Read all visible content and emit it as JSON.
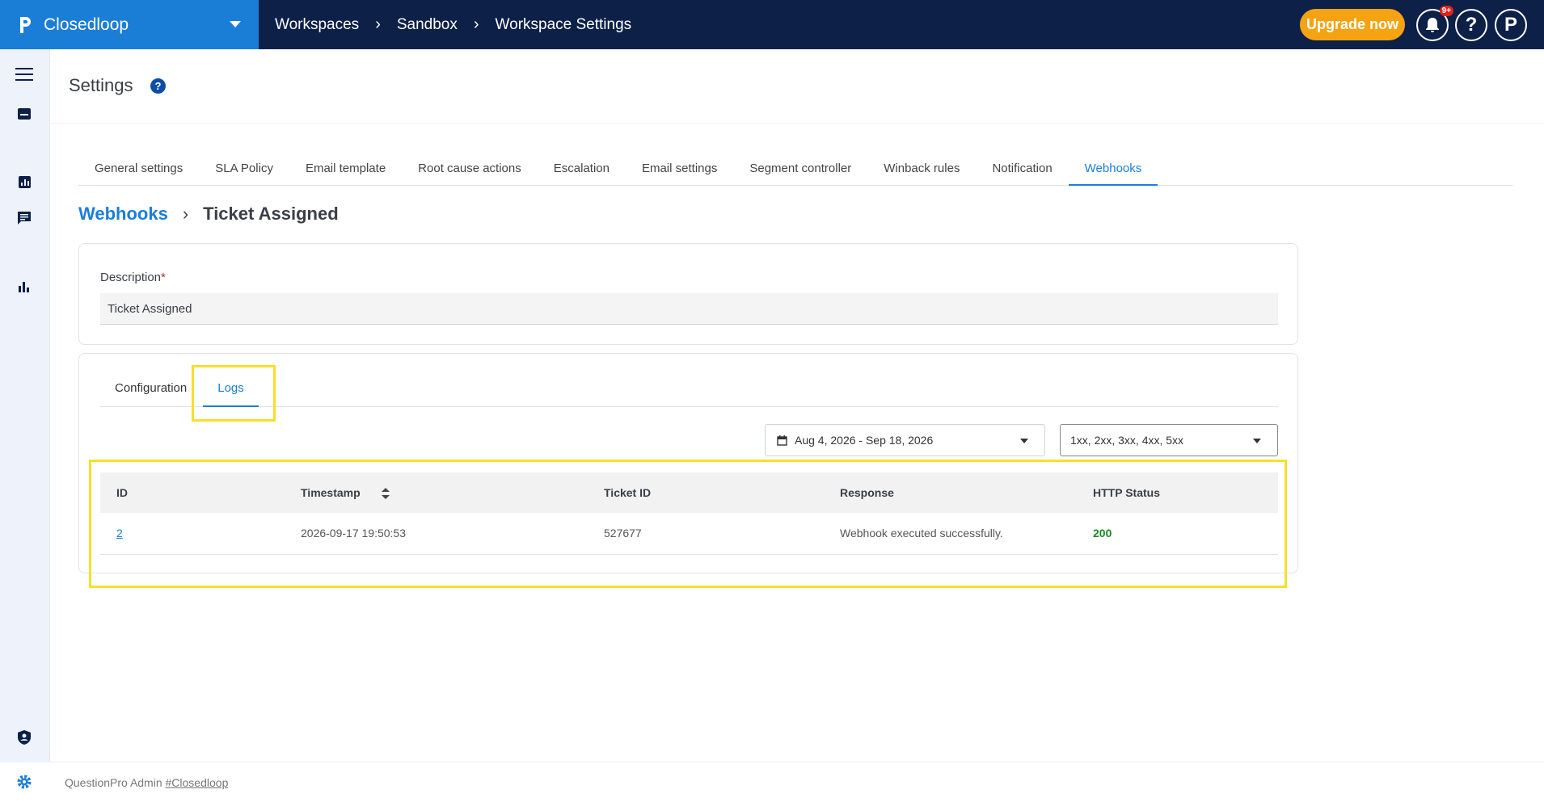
{
  "topbar": {
    "brand_name": "Closedloop",
    "breadcrumbs": [
      "Workspaces",
      "Sandbox",
      "Workspace Settings"
    ],
    "upgrade_label": "Upgrade now",
    "notification_badge": "9+",
    "help_glyph": "?",
    "profile_glyph": "P"
  },
  "sidebar": {
    "icons": [
      "menu-icon",
      "inbox-icon",
      "report-icon",
      "chat-icon",
      "bar-chart-icon",
      "shield-user-icon",
      "gear-icon"
    ]
  },
  "header": {
    "title": "Settings",
    "help_glyph": "?"
  },
  "tabs": [
    {
      "label": "General settings"
    },
    {
      "label": "SLA Policy"
    },
    {
      "label": "Email template"
    },
    {
      "label": "Root cause actions"
    },
    {
      "label": "Escalation"
    },
    {
      "label": "Email settings"
    },
    {
      "label": "Segment controller"
    },
    {
      "label": "Winback rules"
    },
    {
      "label": "Notification"
    },
    {
      "label": "Webhooks"
    }
  ],
  "active_tab": "Webhooks",
  "breadcrumb": {
    "parent": "Webhooks",
    "current": "Ticket Assigned"
  },
  "description": {
    "label": "Description",
    "required_mark": "*",
    "value": "Ticket Assigned"
  },
  "subtabs": [
    {
      "label": "Configuration"
    },
    {
      "label": "Logs"
    }
  ],
  "active_subtab": "Logs",
  "filters": {
    "date_range": "Aug 4, 2026 - Sep 18, 2026",
    "status_codes": "1xx, 2xx, 3xx, 4xx, 5xx"
  },
  "logs_table": {
    "columns": [
      "ID",
      "Timestamp",
      "Ticket ID",
      "Response",
      "HTTP Status"
    ],
    "rows": [
      {
        "id": "2",
        "timestamp": "2026-09-17 19:50:53",
        "ticket_id": "527677",
        "response": "Webhook executed successfully.",
        "http_status": "200"
      }
    ]
  },
  "footer": {
    "text": "QuestionPro Admin",
    "link": "#Closedloop"
  },
  "colors": {
    "topbar": "#0c2048",
    "brand": "#1b7ed6",
    "accent": "#1b7ed6",
    "upgrade": "#f6a313",
    "success": "#1a8a2a",
    "highlight": "#f7df2c"
  }
}
